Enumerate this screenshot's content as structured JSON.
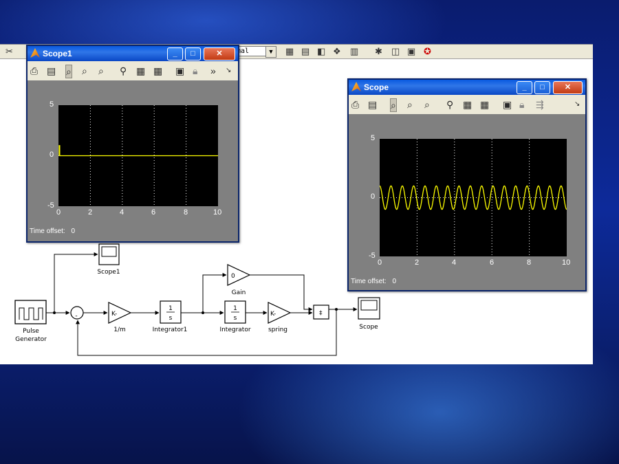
{
  "canvas_toolbar": {
    "sim_mode_value": "mal",
    "dropdown_glyph": "▼"
  },
  "blocks": {
    "pulse_label_1": "Pulse",
    "pulse_label_2": "Generator",
    "sum_minus": "-",
    "gain_inv_m_text": "K-",
    "gain_inv_m_label": "1/m",
    "integrator1_num": "1",
    "integrator1_den": "s",
    "integrator1_label": "Integrator1",
    "integrator_num": "1",
    "integrator_den": "s",
    "integrator_label": "Integrator",
    "gain_text": "0",
    "gain_label": "Gain",
    "spring_text": "K-",
    "spring_label": "spring",
    "mux_text": "‡",
    "scope1_label": "Scope1",
    "scope_label": "Scope"
  },
  "scope1": {
    "title": "Scope1",
    "y_ticks": [
      "5",
      "0",
      "-5"
    ],
    "x_ticks": [
      "0",
      "2",
      "4",
      "6",
      "8",
      "10"
    ],
    "time_offset_label": "Time offset:",
    "time_offset_value": "0",
    "signal": {
      "type": "pulse",
      "pulse_width": 0.08,
      "pulse_height": 1,
      "baseline": 0
    },
    "line_color": "#ffff00"
  },
  "scope": {
    "title": "Scope",
    "y_ticks": [
      "5",
      "0",
      "-5"
    ],
    "x_ticks": [
      "0",
      "2",
      "4",
      "6",
      "8",
      "10"
    ],
    "time_offset_label": "Time offset:",
    "time_offset_value": "0",
    "signal": {
      "type": "sine",
      "amplitude": 1,
      "cycles": 16.5
    },
    "line_color": "#ffff00"
  },
  "colors": {
    "title_bar": "#0a5ae0",
    "plot_bg": "#000000",
    "frame_bg": "#808080",
    "signal": "#ffff00"
  }
}
